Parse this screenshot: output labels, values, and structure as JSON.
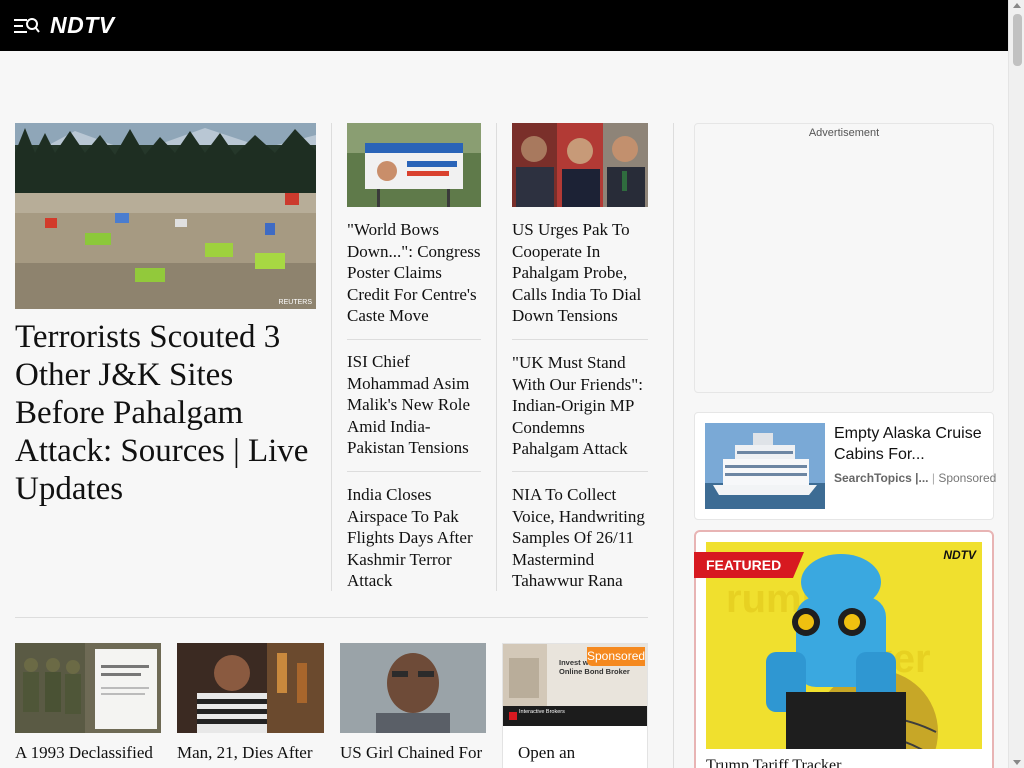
{
  "header": {
    "logo": "NDTV"
  },
  "lead": {
    "image_credit": "REUTERS",
    "title": "Terrorists Scouted 3 Other J&K Sites Before Pahalgam Attack: Sources | Live Updates"
  },
  "column1": [
    "\"World Bows Down...\": Congress Poster Claims Credit For Centre's Caste Move",
    "ISI Chief Mohammad Asim Malik's New Role Amid India-Pakistan Tensions",
    "India Closes Airspace To Pak Flights Days After Kashmir Terror Attack"
  ],
  "column2": [
    "US Urges Pak To Cooperate In Pahalgam Probe, Calls India To Dial Down Tensions",
    "\"UK Must Stand With Our Friends\": Indian-Origin MP Condemns Pahalgam Attack",
    "NIA To Collect Voice, Handwriting Samples Of 26/11 Mastermind Tahawwur Rana"
  ],
  "advertisement": {
    "label": "Advertisement"
  },
  "sponsored_card": {
    "title": "Empty Alaska Cruise Cabins For...",
    "source": "SearchTopics |...",
    "sponsored": "Sponsored"
  },
  "featured": {
    "tag": "FEATURED",
    "logo": "NDTV",
    "caption": "Trump Tariff Tracker"
  },
  "bottom_row": [
    "A 1993 Declassified",
    "Man, 21, Dies After",
    "US Girl Chained For",
    "Open an"
  ],
  "bottom_ad": {
    "badge": "Sponsored",
    "headline": "Invest with the Best Online Bond Broker",
    "brand": "Interactive Brokers"
  }
}
